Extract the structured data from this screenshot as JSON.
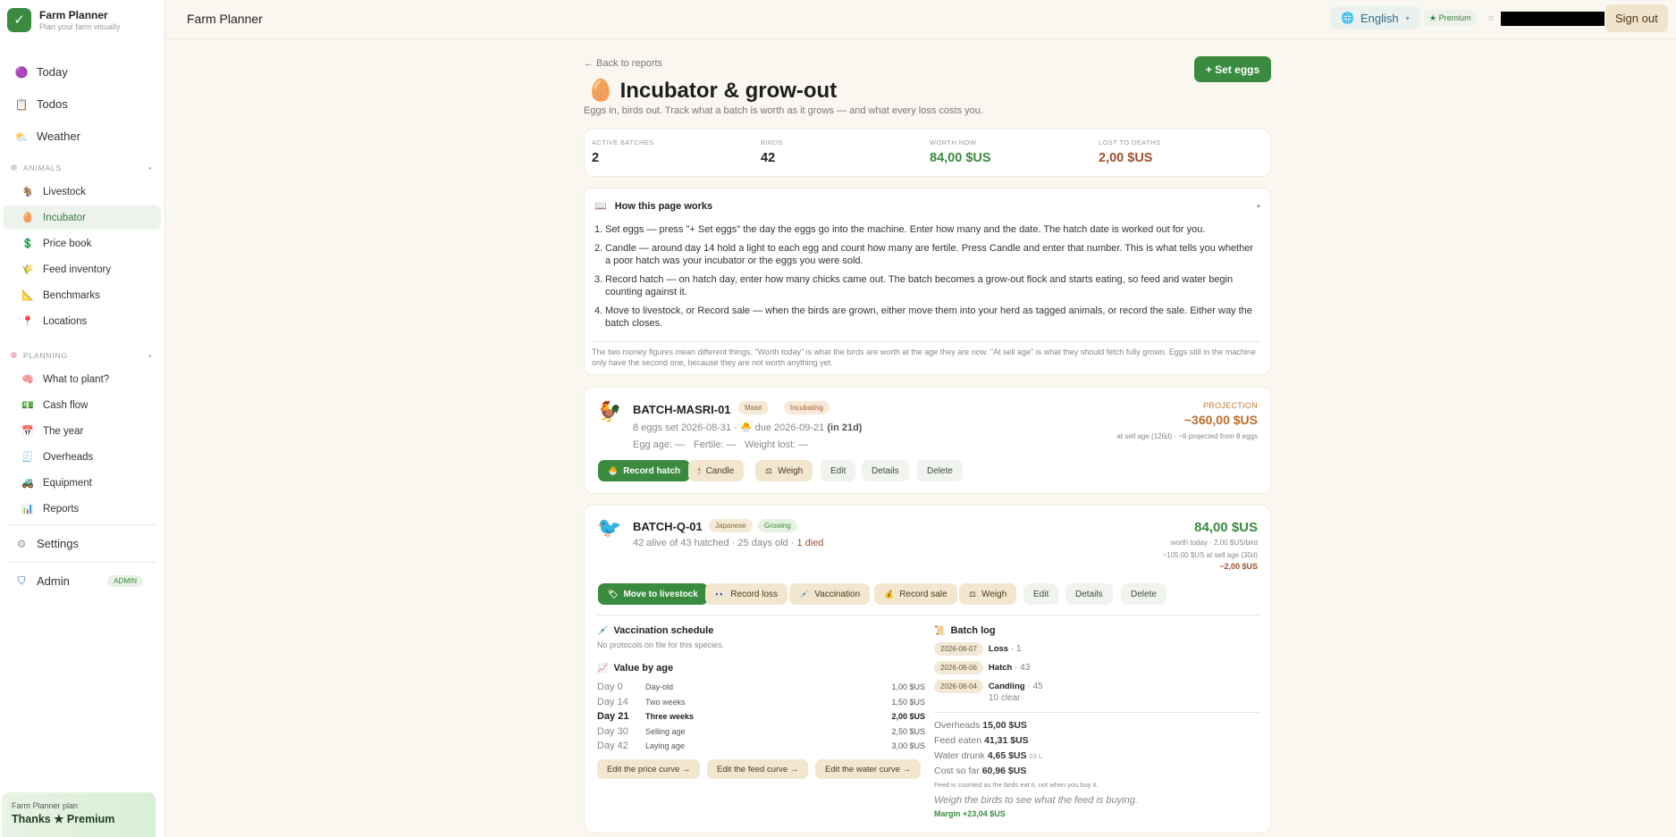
{
  "sidebar": {
    "brand_title": "Farm Planner",
    "brand_sub": "Plan your farm visually",
    "top_items": [
      {
        "label": "Today",
        "icon": "🟣"
      },
      {
        "label": "Todos",
        "icon": "📋"
      },
      {
        "label": "Weather",
        "icon": "⛅"
      }
    ],
    "animals_header": "ANIMALS",
    "animals_items": [
      {
        "label": "Livestock",
        "icon": "🐐"
      },
      {
        "label": "Incubator",
        "icon": "🥚"
      },
      {
        "label": "Price book",
        "icon": "💲"
      },
      {
        "label": "Feed inventory",
        "icon": "🌾"
      },
      {
        "label": "Benchmarks",
        "icon": "📐"
      },
      {
        "label": "Locations",
        "icon": "📍"
      }
    ],
    "planning_header": "PLANNING",
    "planning_items": [
      {
        "label": "What to plant?",
        "icon": "🧠"
      },
      {
        "label": "Cash flow",
        "icon": "💵"
      },
      {
        "label": "The year",
        "icon": "📅"
      },
      {
        "label": "Overheads",
        "icon": "🧾"
      },
      {
        "label": "Equipment",
        "icon": "🚜"
      },
      {
        "label": "Reports",
        "icon": "📊"
      }
    ],
    "settings": "Settings",
    "admin": "Admin",
    "admin_badge": "ADMIN",
    "plan_label": "Farm Planner plan",
    "plan_value": "Thanks ★ Premium"
  },
  "header": {
    "title": "Farm Planner",
    "language": "English",
    "premium": "★ Premium",
    "signout": "Sign out"
  },
  "page": {
    "back": "← Back to reports",
    "set_eggs": "+ Set eggs",
    "title": "Incubator & grow-out",
    "subtitle": "Eggs in, birds out. Track what a batch is worth as it grows — and what every loss costs you."
  },
  "stats": [
    {
      "label": "ACTIVE BATCHES",
      "value": "2",
      "color": "#222222"
    },
    {
      "label": "BIRDS",
      "value": "42",
      "color": "#222222"
    },
    {
      "label": "WORTH NOW",
      "value": "84,00 $US",
      "color": "#3a8b3f"
    },
    {
      "label": "LOST TO DEATHS",
      "value": "2,00 $US",
      "color": "#a0522d"
    }
  ],
  "how": {
    "title": "How this page works",
    "steps": [
      "Set eggs — press \"+ Set eggs\" the day the eggs go into the machine. Enter how many and the date. The hatch date is worked out for you.",
      "Candle — around day 14 hold a light to each egg and count how many are fertile. Press Candle and enter that number. This is what tells you whether a poor hatch was your incubator or the eggs you were sold.",
      "Record hatch — on hatch day, enter how many chicks came out. The batch becomes a grow-out flock and starts eating, so feed and water begin counting against it.",
      "Move to livestock, or Record sale — when the birds are grown, either move them into your herd as tagged animals, or record the sale. Either way the batch closes."
    ],
    "note": "The two money figures mean different things. \"Worth today\" is what the birds are worth at the age they are now. \"At sell age\" is what they should fetch fully grown. Eggs still in the machine only have the second one, because they are not worth anything yet."
  },
  "batch1": {
    "name": "BATCH-MASRI-01",
    "breed": "Masri",
    "status": "Incubating",
    "set_line": "8 eggs set 2026-08-31 · 🐣 due 2026-09-21",
    "due_in": "(in 21d)",
    "egg_age": "Egg age: —",
    "fertile": "Fertile: —",
    "weight_lost": "Weight lost: —",
    "projection_label": "PROJECTION",
    "projection_value": "~360,00 $US",
    "projection_note": "at sell age (126d) · ~6 projected from 8 eggs",
    "buttons": {
      "record_hatch": "Record hatch",
      "candle": "Candle",
      "weigh": "Weigh",
      "edit": "Edit",
      "details": "Details",
      "delete": "Delete"
    }
  },
  "batch2": {
    "name": "BATCH-Q-01",
    "breed": "Japanese",
    "status": "Growing",
    "meta": "42 alive of 43 hatched · 25 days old · ",
    "died": "1 died",
    "worth_value": "84,00 $US",
    "worth_note1": "worth today · 2,00 $US/bird",
    "worth_note2": "~105,00 $US at sell age (30d)",
    "loss": "−2,00 $US",
    "buttons": {
      "move": "Move to livestock",
      "record_loss": "Record loss",
      "vaccination": "Vaccination",
      "record_sale": "Record sale",
      "weigh": "Weigh",
      "edit": "Edit",
      "details": "Details",
      "delete": "Delete"
    },
    "vacc_title": "Vaccination schedule",
    "vacc_note": "No protocols on file for this species.",
    "value_title": "Value by age",
    "curve": [
      {
        "day": "Day 0",
        "label": "Day-old",
        "value": "1,00 $US"
      },
      {
        "day": "Day 14",
        "label": "Two weeks",
        "value": "1,50 $US"
      },
      {
        "day": "Day 21",
        "label": "Three weeks",
        "value": "2,00 $US"
      },
      {
        "day": "Day 30",
        "label": "Selling age",
        "value": "2,50 $US"
      },
      {
        "day": "Day 42",
        "label": "Laying age",
        "value": "3,00 $US"
      }
    ],
    "curve_buttons": {
      "price": "Edit the price curve →",
      "feed": "Edit the feed curve →",
      "water": "Edit the water curve →"
    },
    "log_title": "Batch log",
    "log": [
      {
        "date": "2026-08-07",
        "event": "Loss",
        "detail": " · 1",
        "extra": ""
      },
      {
        "date": "2026-08-06",
        "event": "Hatch",
        "detail": " · 43",
        "extra": ""
      },
      {
        "date": "2026-08-04",
        "event": "Candling",
        "detail": " · 45",
        "extra": "10 clear"
      }
    ],
    "costs": {
      "overheads_label": "Overheads",
      "overheads_value": "15,00 $US",
      "feed_label": "Feed eaten",
      "feed_value": "41,31 $US",
      "water_label": "Water drunk",
      "water_value": "4,65 $US",
      "water_unit": "23 L",
      "cost_label": "Cost so far",
      "cost_value": "60,96 $US",
      "feed_note": "Feed is counted as the birds eat it, not when you buy it.",
      "weigh_hint": "Weigh the birds to see what the feed is buying.",
      "margin": "Margin +23,04 $US"
    }
  }
}
